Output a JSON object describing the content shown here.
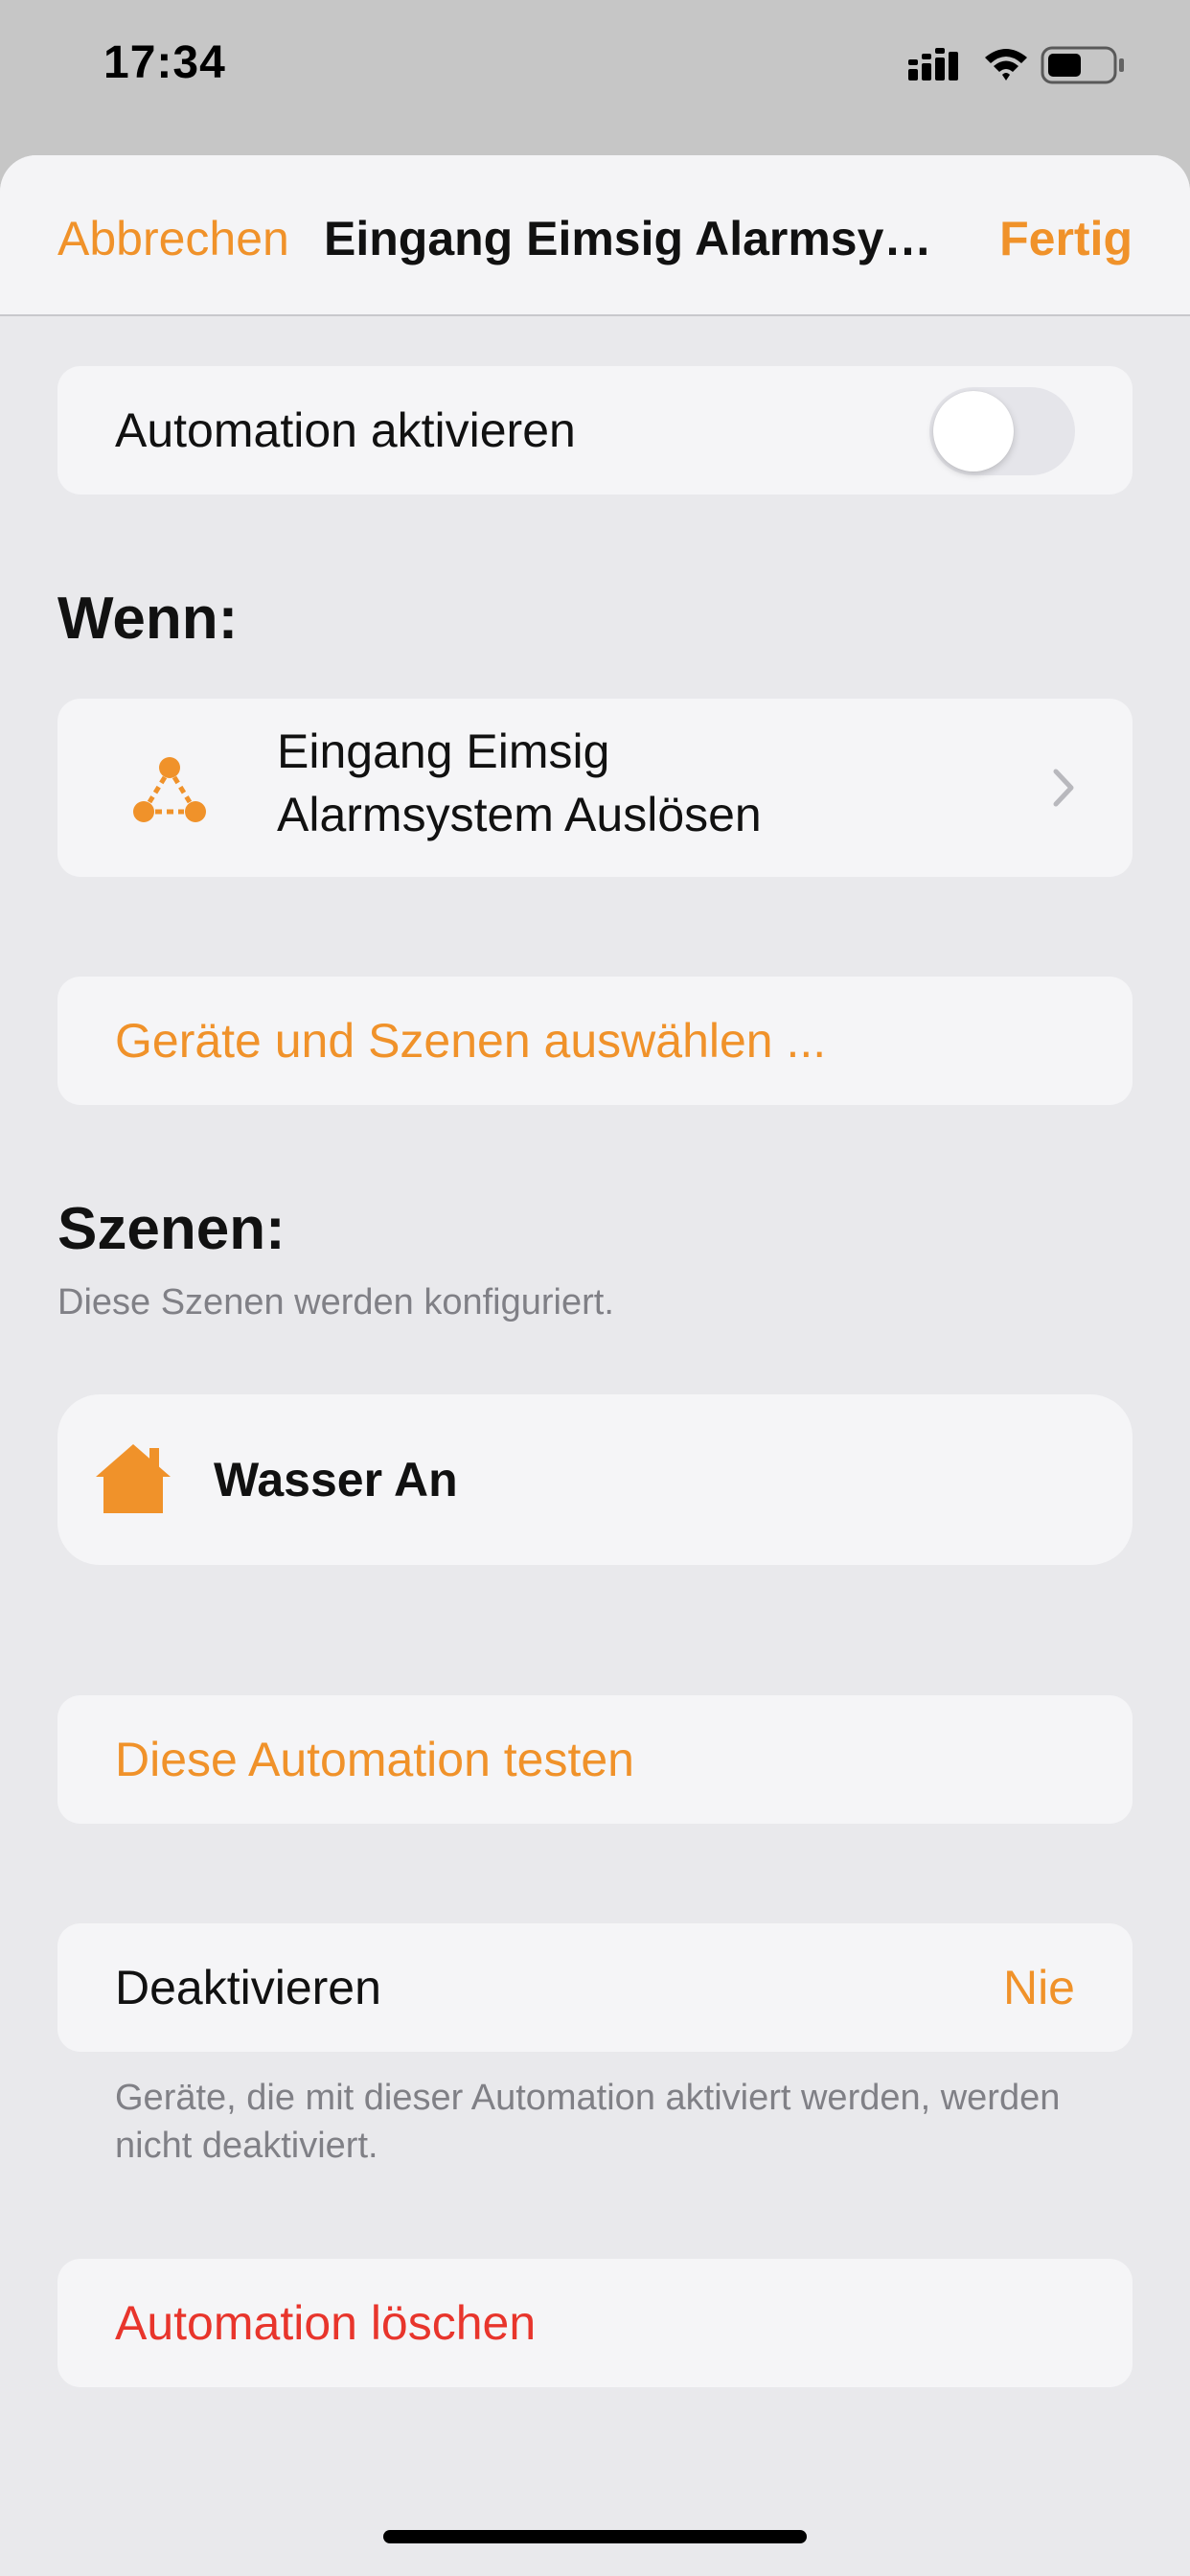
{
  "status_bar": {
    "time": "17:34",
    "icons": [
      "cellular-signal-icon",
      "wifi-icon",
      "battery-icon"
    ]
  },
  "nav": {
    "cancel_label": "Abbrechen",
    "title": "Eingang Eimsig Alarmsyst...",
    "done_label": "Fertig"
  },
  "automation_toggle": {
    "label": "Automation aktivieren",
    "enabled": false
  },
  "trigger_section": {
    "heading": "Wenn:",
    "trigger": {
      "icon": "security-system-icon",
      "line1": "Eingang Eimsig",
      "line2": "Alarmsystem Auslösen"
    }
  },
  "select_devices_label": "Geräte und Szenen auswählen ...",
  "scenes_section": {
    "heading": "Szenen:",
    "subtitle": "Diese Szenen werden konfiguriert.",
    "scenes": [
      {
        "icon": "house-icon",
        "name": "Wasser An"
      }
    ]
  },
  "test_label": "Diese Automation testen",
  "deactivate": {
    "label": "Deaktivieren",
    "value": "Nie",
    "footnote": "Geräte, die mit dieser Automation aktiviert werden, werden nicht deaktiviert."
  },
  "delete_label": "Automation löschen",
  "colors": {
    "accent": "#f0922a",
    "destructive": "#e8352c",
    "background": "#e9e9ec",
    "card": "#f5f5f7",
    "secondary_text": "#808086"
  }
}
